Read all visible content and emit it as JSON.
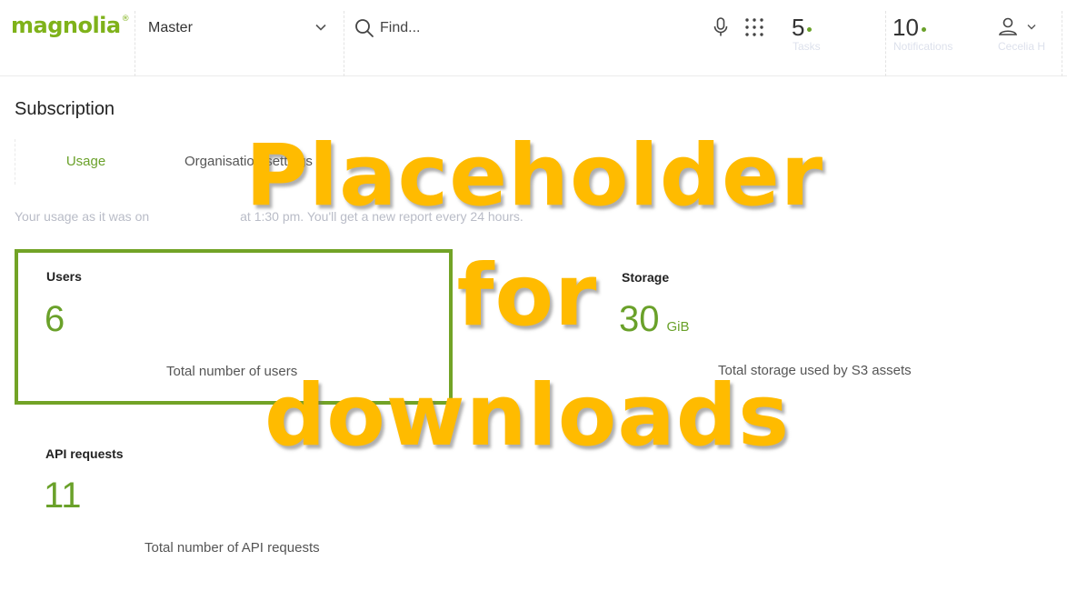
{
  "header": {
    "logo_text": "magnolia",
    "logo_mark": "®",
    "environment": {
      "selected": "Master",
      "icon": "chevron-down-icon"
    },
    "search": {
      "placeholder": "Find...",
      "icon": "search-icon"
    },
    "voice_icon": "microphone-icon",
    "apps_icon": "grid-icon",
    "tasks": {
      "count": "5",
      "label": "Tasks"
    },
    "notifications": {
      "count": "10",
      "label": "Notifications"
    },
    "user": {
      "name": "Cecelia H",
      "icon": "user-icon"
    }
  },
  "page": {
    "title": "Subscription",
    "tabs": [
      {
        "label": "Usage",
        "active": true
      },
      {
        "label": "Organisation settings",
        "active": false
      }
    ],
    "usage_note_start": "Your usage as it was on",
    "usage_note_end": "at 1:30 pm. You'll get a new report every 24 hours."
  },
  "cards": {
    "users": {
      "title": "Users",
      "value": "6",
      "description": "Total number of users"
    },
    "storage": {
      "title": "Storage",
      "value": "30",
      "unit": "GiB",
      "description": "Total storage used by S3 assets"
    },
    "api": {
      "title": "API requests",
      "value": "11",
      "description": "Total number of API requests"
    }
  },
  "overlay": {
    "line1": "Placeholder",
    "line2": "for",
    "line3": "downloads"
  },
  "colors": {
    "brand": "#7fb21a",
    "accent": "#6aa12a",
    "highlight_border": "#72a326",
    "overlay": "#ffbb00",
    "muted": "#b9bcc7"
  }
}
